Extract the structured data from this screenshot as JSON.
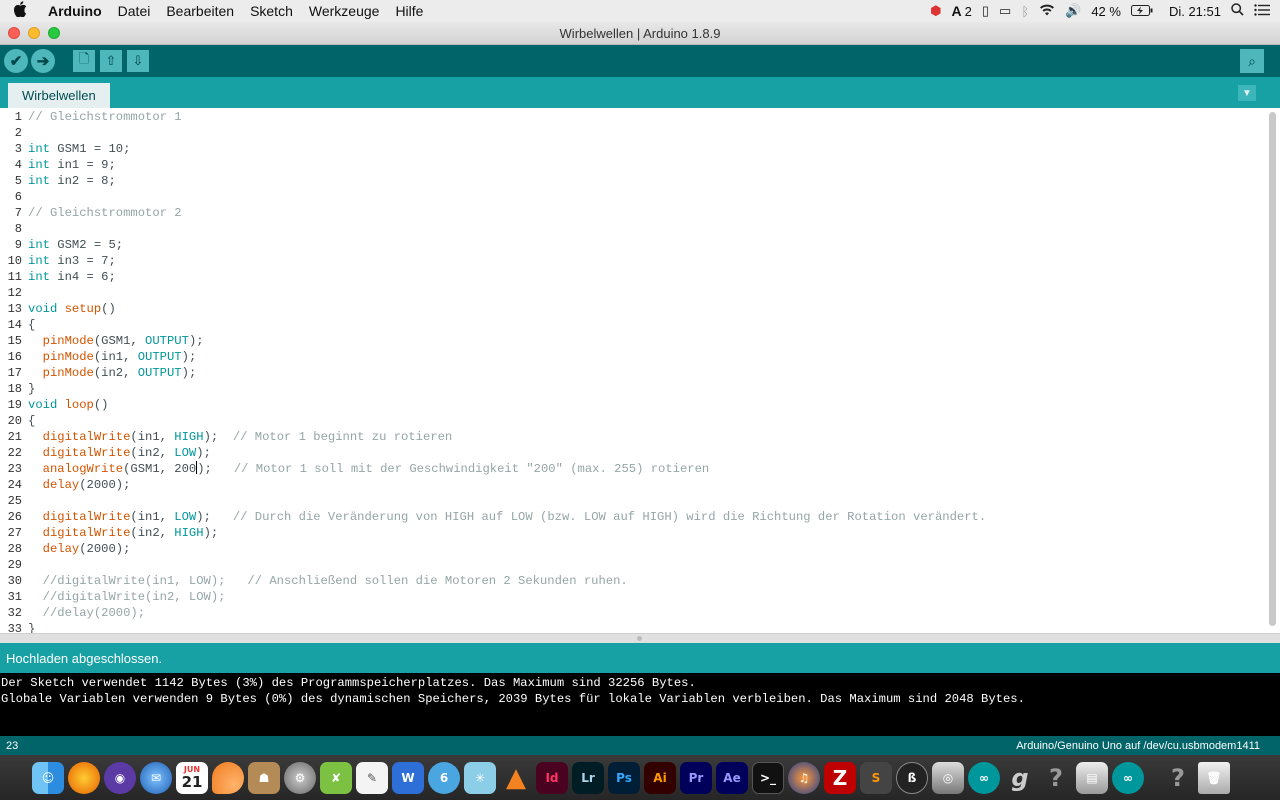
{
  "menubar": {
    "apple_icon": "",
    "items": [
      "Arduino",
      "Datei",
      "Bearbeiten",
      "Sketch",
      "Werkzeuge",
      "Hilfe"
    ],
    "adobe_count": "2",
    "battery": "42 %",
    "clock": "Di. 21:51"
  },
  "window": {
    "title": "Wirbelwellen | Arduino 1.8.9"
  },
  "toolbar": {
    "verify_icon": "✔",
    "upload_icon": "➔",
    "new_icon": "🗋",
    "open_icon": "⇧",
    "save_icon": "⇩",
    "serial_icon": "⌕"
  },
  "tab": {
    "label": "Wirbelwellen",
    "menu_icon": "▼"
  },
  "editor": {
    "line_numbers": [
      "1",
      "2",
      "3",
      "4",
      "5",
      "6",
      "7",
      "8",
      "9",
      "10",
      "11",
      "12",
      "13",
      "14",
      "15",
      "16",
      "17",
      "18",
      "19",
      "20",
      "21",
      "22",
      "23",
      "24",
      "25",
      "26",
      "27",
      "28",
      "29",
      "30",
      "31",
      "32",
      "33"
    ],
    "lines": [
      "// Gleichstrommotor 1",
      "",
      "int GSM1 = 10;",
      "int in1 = 9;",
      "int in2 = 8;",
      "",
      "// Gleichstrommotor 2",
      "",
      "int GSM2 = 5;",
      "int in3 = 7;",
      "int in4 = 6;",
      "",
      "void setup()",
      "{",
      "  pinMode(GSM1, OUTPUT);",
      "  pinMode(in1, OUTPUT);",
      "  pinMode(in2, OUTPUT);",
      "}",
      "void loop()",
      "{",
      "  digitalWrite(in1, HIGH);  // Motor 1 beginnt zu rotieren",
      "  digitalWrite(in2, LOW);",
      "  analogWrite(GSM1, 200);   // Motor 1 soll mit der Geschwindigkeit \"200\" (max. 255) rotieren",
      "  delay(2000);",
      "",
      "  digitalWrite(in1, LOW);   // Durch die Veränderung von HIGH auf LOW (bzw. LOW auf HIGH) wird die Richtung der Rotation verändert.",
      "  digitalWrite(in2, HIGH);",
      "  delay(2000);",
      "",
      "  //digitalWrite(in1, LOW);   // Anschließend sollen die Motoren 2 Sekunden ruhen.",
      "  //digitalWrite(in2, LOW);",
      "  //delay(2000);",
      "}"
    ]
  },
  "status": {
    "message": "Hochladen abgeschlossen."
  },
  "console": {
    "lines": [
      "Der Sketch verwendet 1142 Bytes (3%) des Programmspeicherplatzes. Das Maximum sind 32256 Bytes.",
      "Globale Variablen verwenden 9 Bytes (0%) des dynamischen Speichers, 2039 Bytes für lokale Variablen verbleiben. Das Maximum sind 2048 Bytes."
    ]
  },
  "footer": {
    "line_number": "23",
    "board": "Arduino/Genuino Uno auf /dev/cu.usbmodem1411"
  },
  "dock": {
    "calendar_month": "JUN",
    "calendar_day": "21",
    "app_labels": [
      "Id",
      "Lr",
      "Ps",
      "Ai",
      "Pr",
      "Ae"
    ]
  },
  "colors": {
    "toolbar": "#006468",
    "tabbar": "#17a1a5",
    "keyword": "#00979c",
    "function": "#d35400",
    "comment": "#95a5a6"
  }
}
